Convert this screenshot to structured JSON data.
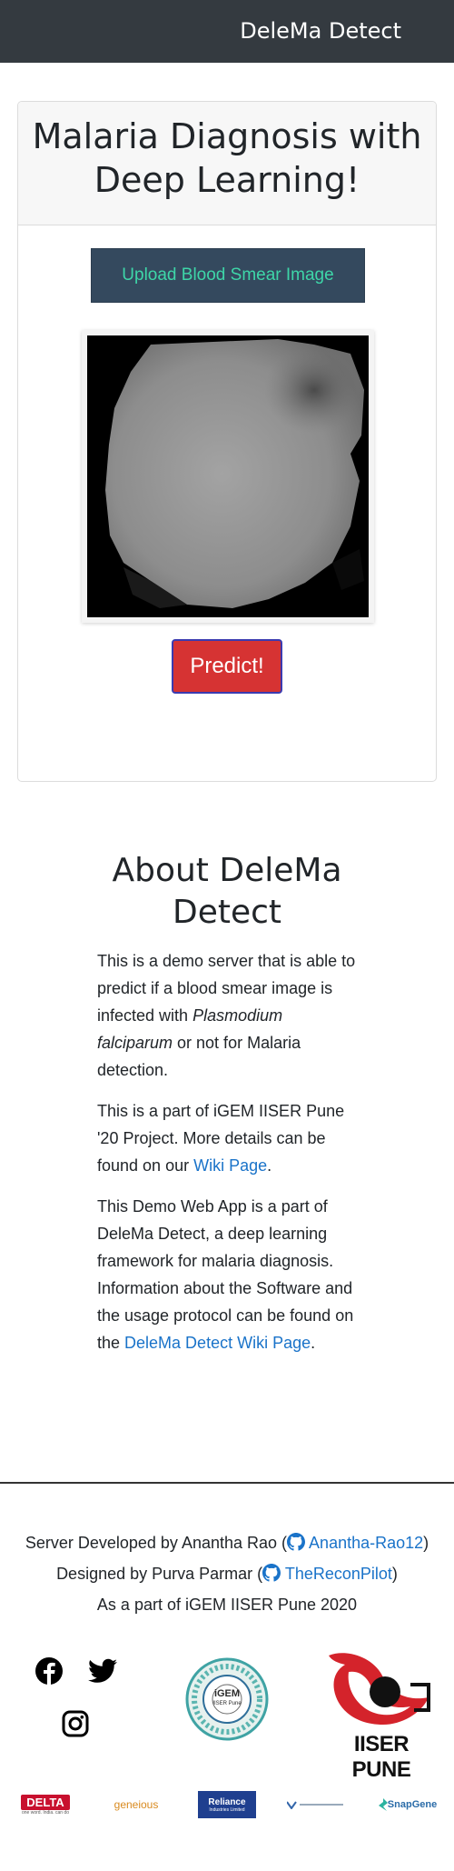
{
  "navbar": {
    "brand": "DeleMa Detect"
  },
  "diagnosis": {
    "title": "Malaria Diagnosis with Deep Learning!",
    "upload_label": "Upload Blood Smear Image",
    "predict_label": "Predict!"
  },
  "about": {
    "title": "About DeleMa Detect",
    "p1_before": "This is a demo server that is able to predict if a blood smear image is infected with ",
    "p1_italic": "Plasmodium falciparum",
    "p1_after": " or not for Malaria detection.",
    "p2_before": "This is a part of iGEM IISER Pune '20 Project. More details can be found on our ",
    "p2_link": "Wiki Page",
    "p2_after": ".",
    "p3_before": "This Demo Web App is a part of DeleMa Detect, a deep learning framework for malaria diagnosis. Information about the Software and the usage protocol can be found on the ",
    "p3_link": "DeleMa Detect Wiki Page",
    "p3_after": "."
  },
  "footer": {
    "dev_before": "Server Developed by Anantha Rao (",
    "dev_link": "Anantha-Rao12",
    "dev_after": ")",
    "design_before": "Designed by Purva Parmar (",
    "design_link": "TheReconPilot",
    "design_after": ")",
    "part_of": "As a part of iGEM IISER Pune 2020",
    "iisers_logo_text": "IISER PUNE",
    "igem_badge_text": "iGEM",
    "igem_badge_sub": "IISER Pune",
    "sponsors": {
      "delta": "DELTA",
      "delta_sub": "one word. India. can do",
      "geneious": "geneious",
      "reliance": "Reliance",
      "reliance_sub": "Industries Limited",
      "snapgene": "SnapGene"
    }
  },
  "colors": {
    "navbar_bg": "#343a40",
    "upload_bg": "#34495e",
    "upload_text": "#3ed6a8",
    "predict_bg": "#d63333",
    "link": "#1a73c9"
  }
}
